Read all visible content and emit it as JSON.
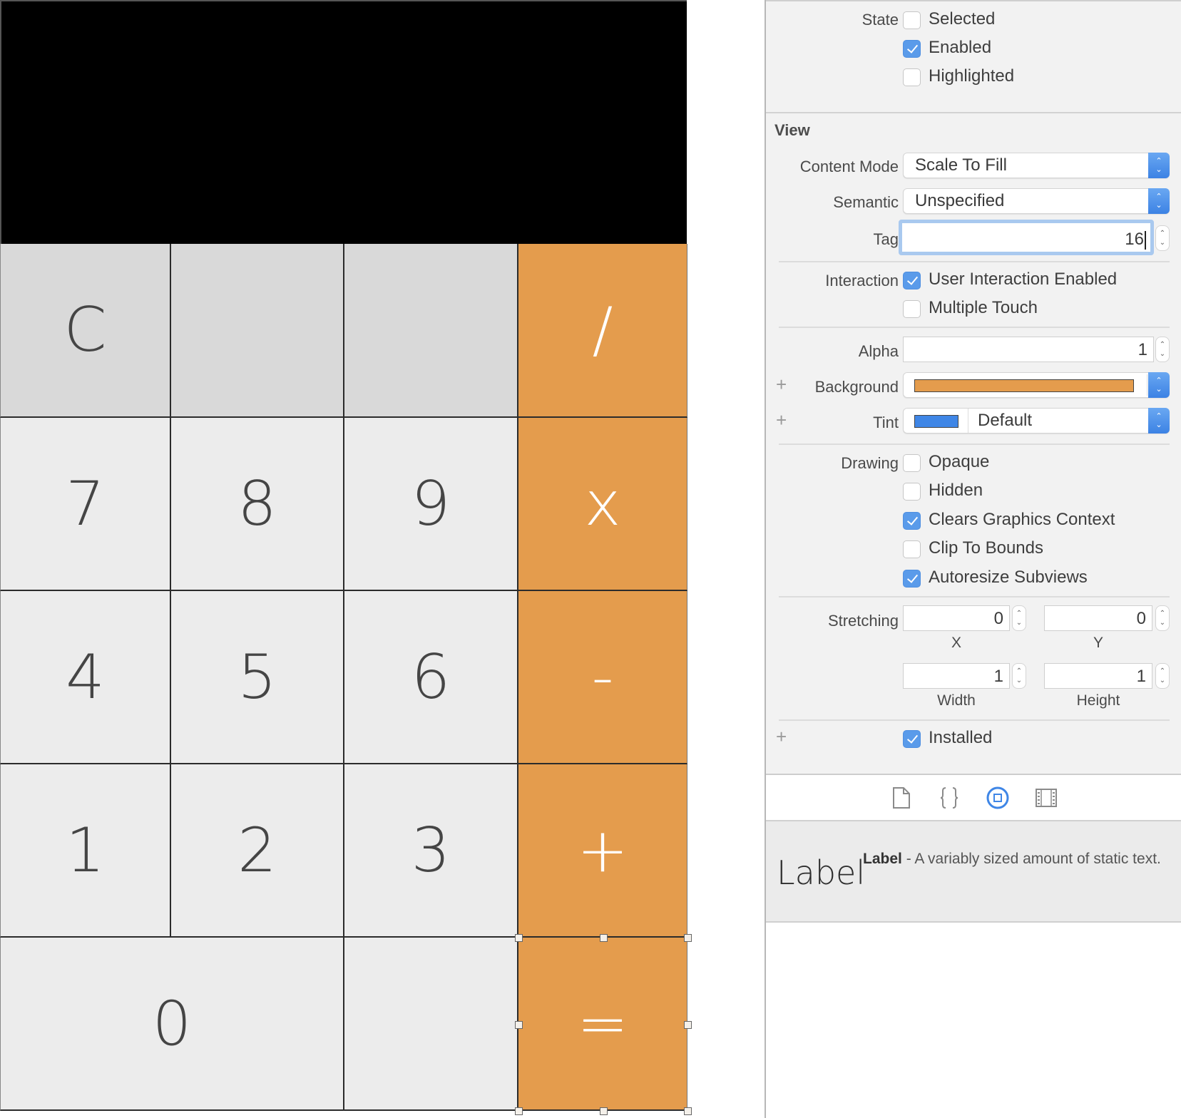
{
  "calculator": {
    "display_text": "",
    "keys": [
      {
        "label": "C",
        "kind": "func",
        "name": "key-clear"
      },
      {
        "label": "",
        "kind": "func",
        "name": "key-blank-1"
      },
      {
        "label": "",
        "kind": "func",
        "name": "key-blank-2"
      },
      {
        "label": "/",
        "kind": "op",
        "name": "key-divide"
      },
      {
        "label": "7",
        "kind": "num",
        "name": "key-7"
      },
      {
        "label": "8",
        "kind": "num",
        "name": "key-8"
      },
      {
        "label": "9",
        "kind": "num",
        "name": "key-9"
      },
      {
        "label": "x",
        "kind": "op",
        "name": "key-multiply"
      },
      {
        "label": "4",
        "kind": "num",
        "name": "key-4"
      },
      {
        "label": "5",
        "kind": "num",
        "name": "key-5"
      },
      {
        "label": "6",
        "kind": "num",
        "name": "key-6"
      },
      {
        "label": "-",
        "kind": "op",
        "name": "key-subtract"
      },
      {
        "label": "1",
        "kind": "num",
        "name": "key-1"
      },
      {
        "label": "2",
        "kind": "num",
        "name": "key-2"
      },
      {
        "label": "3",
        "kind": "num",
        "name": "key-3"
      },
      {
        "label": "+",
        "kind": "op",
        "name": "key-add"
      },
      {
        "label": "0",
        "kind": "num",
        "name": "key-0"
      },
      {
        "label": "",
        "kind": "num",
        "name": "key-blank-3"
      },
      {
        "label": "=",
        "kind": "op",
        "name": "key-equals"
      }
    ],
    "selected_key": "key-equals",
    "colors": {
      "operator": "#e49c4d",
      "function": "#d9d9d9",
      "number": "#ececec",
      "display": "#000000"
    }
  },
  "inspector": {
    "state": {
      "label": "State",
      "options": [
        {
          "label": "Selected",
          "checked": false
        },
        {
          "label": "Enabled",
          "checked": true
        },
        {
          "label": "Highlighted",
          "checked": false
        }
      ]
    },
    "view": {
      "title": "View",
      "content_mode": {
        "label": "Content Mode",
        "value": "Scale To Fill"
      },
      "semantic": {
        "label": "Semantic",
        "value": "Unspecified"
      },
      "tag": {
        "label": "Tag",
        "value": "16"
      },
      "interaction": {
        "label": "Interaction",
        "options": [
          {
            "label": "User Interaction Enabled",
            "checked": true
          },
          {
            "label": "Multiple Touch",
            "checked": false
          }
        ]
      },
      "alpha": {
        "label": "Alpha",
        "value": "1"
      },
      "background": {
        "label": "Background",
        "color": "#e49c4d"
      },
      "tint": {
        "label": "Tint",
        "color": "#3f86e6",
        "value": "Default"
      },
      "drawing": {
        "label": "Drawing",
        "options": [
          {
            "label": "Opaque",
            "checked": false
          },
          {
            "label": "Hidden",
            "checked": false
          },
          {
            "label": "Clears Graphics Context",
            "checked": true
          },
          {
            "label": "Clip To Bounds",
            "checked": false
          },
          {
            "label": "Autoresize Subviews",
            "checked": true
          }
        ]
      },
      "stretching": {
        "label": "Stretching",
        "x": {
          "label": "X",
          "value": "0"
        },
        "y": {
          "label": "Y",
          "value": "0"
        },
        "width": {
          "label": "Width",
          "value": "1"
        },
        "height": {
          "label": "Height",
          "value": "1"
        }
      },
      "installed": {
        "label": "Installed",
        "checked": true
      }
    },
    "library_tabs": [
      {
        "name": "file-template-icon",
        "selected": false
      },
      {
        "name": "code-snippet-icon",
        "selected": false
      },
      {
        "name": "object-library-icon",
        "selected": true
      },
      {
        "name": "media-library-icon",
        "selected": false
      }
    ],
    "library_item": {
      "preview": "Label",
      "title": "Label",
      "description": " - A variably sized amount of static text."
    }
  }
}
